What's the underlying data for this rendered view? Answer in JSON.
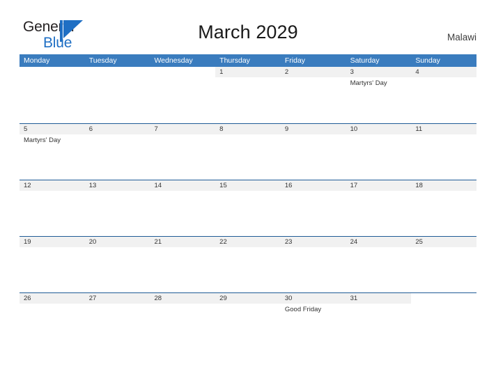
{
  "brand": {
    "line1": "General",
    "line2": "Blue",
    "mark_icon": "triangle-logo-icon",
    "color_primary": "#1f6fc4",
    "color_text": "#231f20"
  },
  "header": {
    "title": "March 2029",
    "country": "Malawi"
  },
  "theme": {
    "header_blue": "#3a7cbe",
    "row_border": "#1f5b96",
    "date_strip": "#f1f1f1",
    "text": "#333333"
  },
  "calendar": {
    "weekdays": [
      "Monday",
      "Tuesday",
      "Wednesday",
      "Thursday",
      "Friday",
      "Saturday",
      "Sunday"
    ],
    "weeks": [
      [
        {
          "date": "",
          "event": ""
        },
        {
          "date": "",
          "event": ""
        },
        {
          "date": "",
          "event": ""
        },
        {
          "date": "1",
          "event": ""
        },
        {
          "date": "2",
          "event": ""
        },
        {
          "date": "3",
          "event": "Martyrs' Day"
        },
        {
          "date": "4",
          "event": ""
        }
      ],
      [
        {
          "date": "5",
          "event": "Martyrs' Day"
        },
        {
          "date": "6",
          "event": ""
        },
        {
          "date": "7",
          "event": ""
        },
        {
          "date": "8",
          "event": ""
        },
        {
          "date": "9",
          "event": ""
        },
        {
          "date": "10",
          "event": ""
        },
        {
          "date": "11",
          "event": ""
        }
      ],
      [
        {
          "date": "12",
          "event": ""
        },
        {
          "date": "13",
          "event": ""
        },
        {
          "date": "14",
          "event": ""
        },
        {
          "date": "15",
          "event": ""
        },
        {
          "date": "16",
          "event": ""
        },
        {
          "date": "17",
          "event": ""
        },
        {
          "date": "18",
          "event": ""
        }
      ],
      [
        {
          "date": "19",
          "event": ""
        },
        {
          "date": "20",
          "event": ""
        },
        {
          "date": "21",
          "event": ""
        },
        {
          "date": "22",
          "event": ""
        },
        {
          "date": "23",
          "event": ""
        },
        {
          "date": "24",
          "event": ""
        },
        {
          "date": "25",
          "event": ""
        }
      ],
      [
        {
          "date": "26",
          "event": ""
        },
        {
          "date": "27",
          "event": ""
        },
        {
          "date": "28",
          "event": ""
        },
        {
          "date": "29",
          "event": ""
        },
        {
          "date": "30",
          "event": "Good Friday"
        },
        {
          "date": "31",
          "event": ""
        },
        {
          "date": "",
          "event": ""
        }
      ]
    ]
  }
}
